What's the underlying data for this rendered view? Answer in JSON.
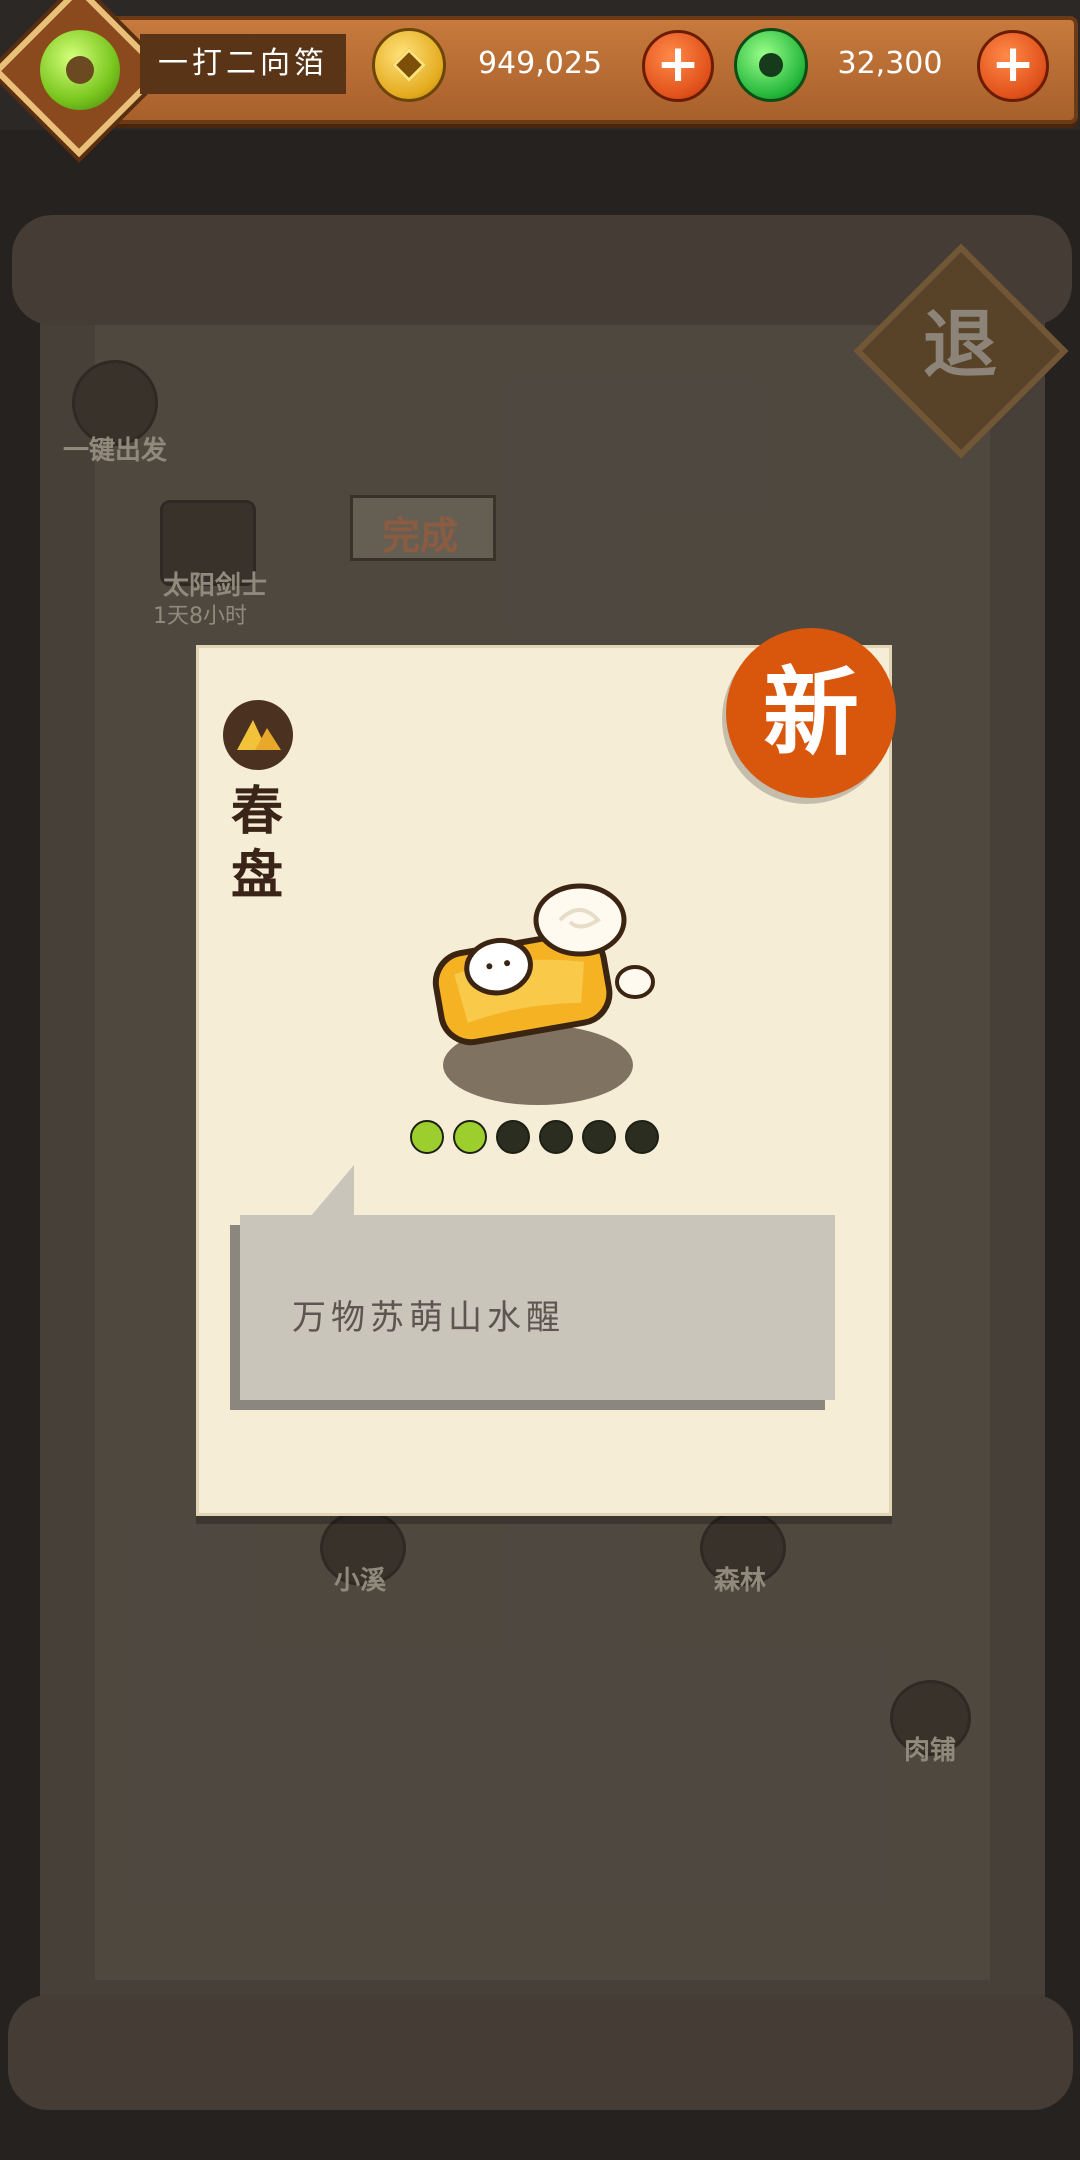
{
  "header": {
    "player_name": "一打二向箔",
    "coins": "949,025",
    "jade": "32,300",
    "add_label": "+"
  },
  "map": {
    "quick_depart": "一键出发",
    "completed_label": "完成",
    "character_name": "太阳剑士",
    "character_timer": "1天8小时",
    "stream_label": "小溪",
    "forest_label": "森林",
    "butcher_label": "肉铺",
    "exit_label": "退"
  },
  "card": {
    "badge_new": "新",
    "item_name": "春盘",
    "description": "万物苏萌山水醒",
    "rarity": {
      "filled": 2,
      "total": 6
    },
    "colors": {
      "filled": "#9ccf2e",
      "empty": "#2a2d1f",
      "badge": "#d9560d"
    }
  }
}
